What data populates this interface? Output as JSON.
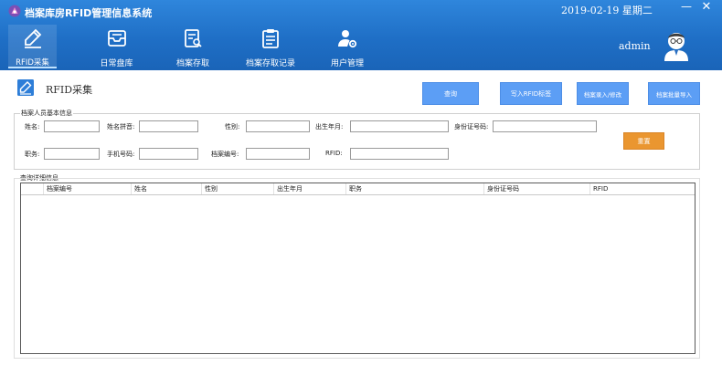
{
  "app": {
    "title": "档案库房RFID管理信息系统"
  },
  "header": {
    "datetime": "2019-02-19 星期二",
    "username": "admin"
  },
  "nav": {
    "items": [
      {
        "label": "RFID采集",
        "icon": "pen-icon",
        "active": true
      },
      {
        "label": "日常盘库",
        "icon": "inbox-icon",
        "active": false
      },
      {
        "label": "档案存取",
        "icon": "document-search-icon",
        "active": false
      },
      {
        "label": "档案存取记录",
        "icon": "clipboard-icon",
        "active": false
      },
      {
        "label": "用户管理",
        "icon": "user-gear-icon",
        "active": false
      }
    ]
  },
  "page": {
    "title": "RFID采集"
  },
  "actions": {
    "query": "查询",
    "write_rfid": "写入RFID标签",
    "entry_edit": "档案录入/修改",
    "batch_import": "档案批量导入",
    "reset": "重置"
  },
  "form": {
    "legend": "档案人员基本信息",
    "fields": {
      "name": {
        "label": "姓名:",
        "value": ""
      },
      "pinyin": {
        "label": "姓名拼音:",
        "value": ""
      },
      "gender": {
        "label": "性别:",
        "value": ""
      },
      "birth": {
        "label": "出生年月:",
        "value": ""
      },
      "id_number": {
        "label": "身份证号码:",
        "value": ""
      },
      "position": {
        "label": "职务:",
        "value": ""
      },
      "phone": {
        "label": "手机号码:",
        "value": ""
      },
      "archive_no": {
        "label": "档案编号:",
        "value": ""
      },
      "rfid": {
        "label": "RFID:",
        "value": ""
      }
    }
  },
  "results": {
    "legend": "查询详细信息",
    "columns": [
      "档案编号",
      "姓名",
      "性别",
      "出生年月",
      "职务",
      "身份证号码",
      "RFID"
    ],
    "rows": []
  },
  "colors": {
    "header_blue": "#1f6fc6",
    "button_blue": "#5c9ef5",
    "button_orange": "#ea9630"
  }
}
